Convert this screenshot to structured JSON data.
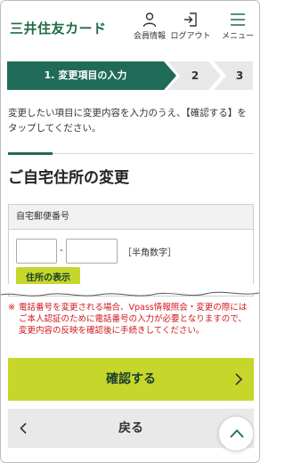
{
  "header": {
    "logo": "三井住友カード",
    "member_info": "会員情報",
    "logout": "ログアウト",
    "menu": "メニュー"
  },
  "steps": [
    {
      "label": "1. 変更項目の入力",
      "active": true
    },
    {
      "label": "2",
      "active": false
    },
    {
      "label": "3",
      "active": false
    }
  ],
  "instruction": "変更したい項目に変更内容を入力のうえ、【確認する】をタップしてください。",
  "section_title": "ご自宅住所の変更",
  "postal": {
    "label": "自宅郵便番号",
    "zip1_value": "",
    "zip2_value": "",
    "separator": "-",
    "note": "［半角数字］",
    "address_button": "住所の表示"
  },
  "warning": {
    "mark": "※",
    "text": "電話番号を変更される場合、Vpass情報照会・変更の際にはご本人認証のために電話番号の入力が必要となりますので、変更内容の反映を確認後に手続きしてください。"
  },
  "buttons": {
    "confirm": "確認する",
    "back": "戻る"
  },
  "colors": {
    "brand_green": "#1f6b57",
    "accent_lime": "#c6d62a",
    "warning_red": "#d0171c"
  },
  "icons": [
    "person-icon",
    "logout-icon",
    "menu-icon",
    "chevron-right-icon",
    "chevron-left-icon",
    "chevron-up-icon"
  ]
}
